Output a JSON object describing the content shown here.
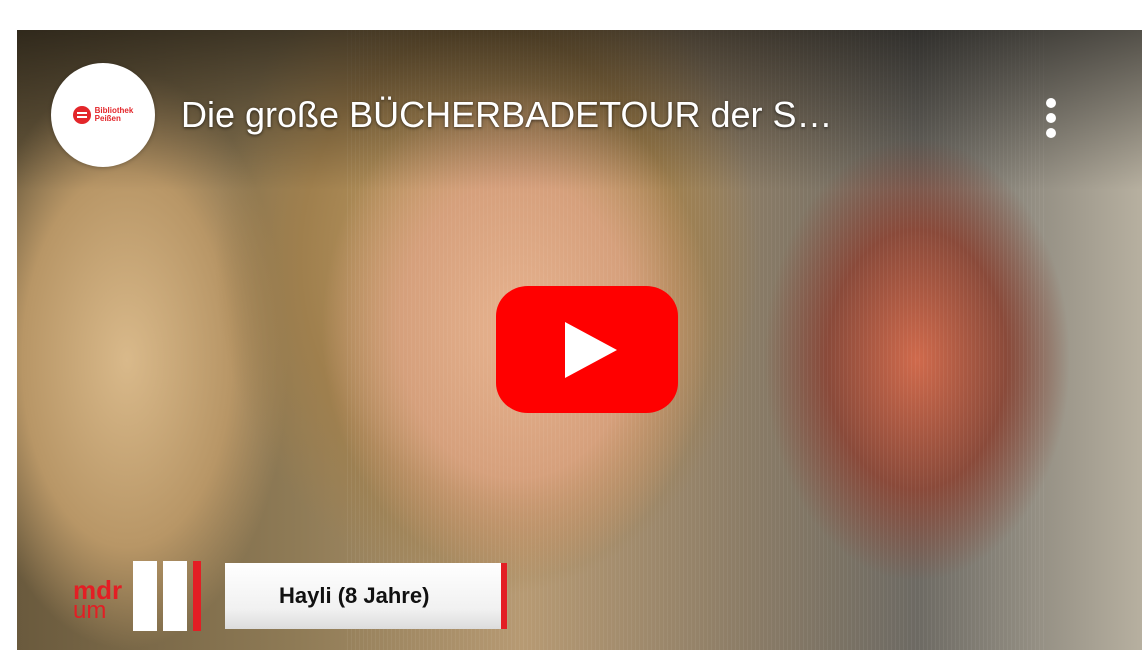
{
  "video": {
    "title": "Die große BÜCHERBADETOUR der S…",
    "channel_logo": {
      "line1": "Bibliothek",
      "line2": "Peißen",
      "brand_color": "#e3262a"
    },
    "more_menu_icon": "vertical-ellipsis-icon",
    "play_button": {
      "icon": "play-icon",
      "color": "#ff0000"
    }
  },
  "thumbnail": {
    "broadcaster_logo": {
      "line1": "mdr",
      "line2": "um",
      "color": "#e31e24"
    },
    "lower_third_name": "Hayli (8 Jahre)"
  }
}
